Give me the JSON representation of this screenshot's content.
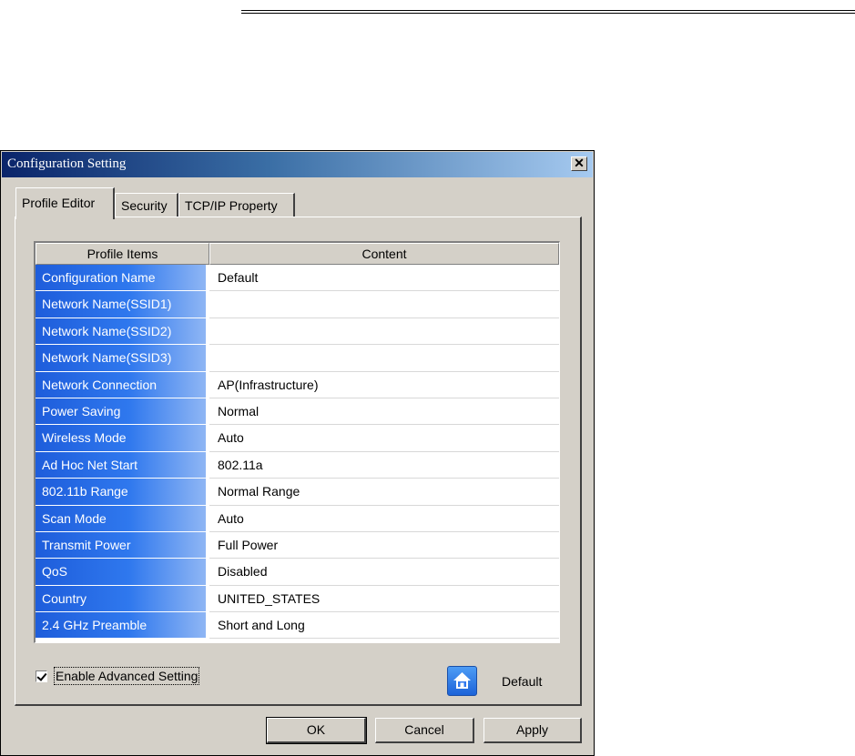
{
  "window": {
    "title": "Configuration Setting",
    "close_glyph": "✕"
  },
  "tabs": [
    {
      "label": "Profile Editor",
      "active": true
    },
    {
      "label": "Security",
      "active": false
    },
    {
      "label": "TCP/IP Property",
      "active": false
    }
  ],
  "grid": {
    "headers": {
      "items": "Profile Items",
      "content": "Content"
    },
    "rows": [
      {
        "item": "Configuration Name",
        "content": "Default"
      },
      {
        "item": "Network Name(SSID1)",
        "content": ""
      },
      {
        "item": "Network Name(SSID2)",
        "content": ""
      },
      {
        "item": "Network Name(SSID3)",
        "content": ""
      },
      {
        "item": "Network Connection",
        "content": "AP(Infrastructure)"
      },
      {
        "item": "Power Saving",
        "content": "Normal"
      },
      {
        "item": "Wireless Mode",
        "content": "Auto"
      },
      {
        "item": "Ad Hoc Net Start",
        "content": "802.11a"
      },
      {
        "item": "802.11b Range",
        "content": "Normal Range"
      },
      {
        "item": "Scan Mode",
        "content": "Auto"
      },
      {
        "item": "Transmit Power",
        "content": "Full Power"
      },
      {
        "item": "QoS",
        "content": "Disabled"
      },
      {
        "item": "Country",
        "content": "UNITED_STATES"
      },
      {
        "item": "2.4 GHz Preamble",
        "content": "Short and Long"
      }
    ]
  },
  "advanced": {
    "label": "Enable Advanced Setting",
    "checked": true
  },
  "default_button": {
    "label": "Default",
    "icon": "home-icon"
  },
  "buttons": {
    "ok": "OK",
    "cancel": "Cancel",
    "apply": "Apply"
  },
  "colors": {
    "dialog_bg": "#d4d0c8",
    "title_start": "#0a246a",
    "title_end": "#a6caf0",
    "item_cell_start": "#1e5ddb",
    "item_cell_end": "#8fb6f4"
  }
}
